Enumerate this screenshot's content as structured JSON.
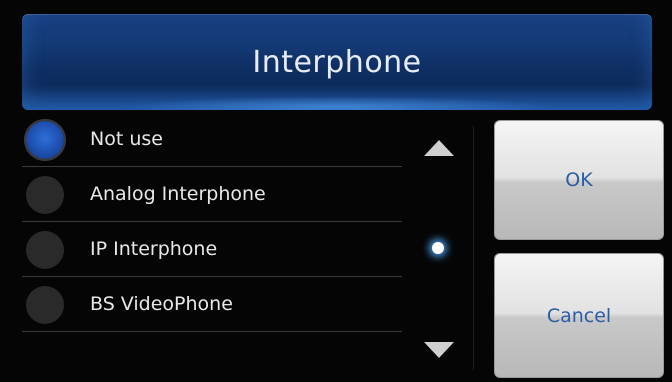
{
  "dialog": {
    "title": "Interphone"
  },
  "options": [
    {
      "label": "Not use",
      "selected": true
    },
    {
      "label": "Analog Interphone",
      "selected": false
    },
    {
      "label": "IP Interphone",
      "selected": false
    },
    {
      "label": "BS VideoPhone",
      "selected": false
    }
  ],
  "scrollbar": {
    "up_icon": "triangle-up-icon",
    "down_icon": "triangle-down-icon",
    "position_indicator": "dot"
  },
  "buttons": {
    "ok_label": "OK",
    "cancel_label": "Cancel"
  },
  "colors": {
    "title_bar": "#143a76",
    "selected_radio": "#1d4fae",
    "button_text": "#2a5da6",
    "indicator_glow": "#50aaff"
  }
}
